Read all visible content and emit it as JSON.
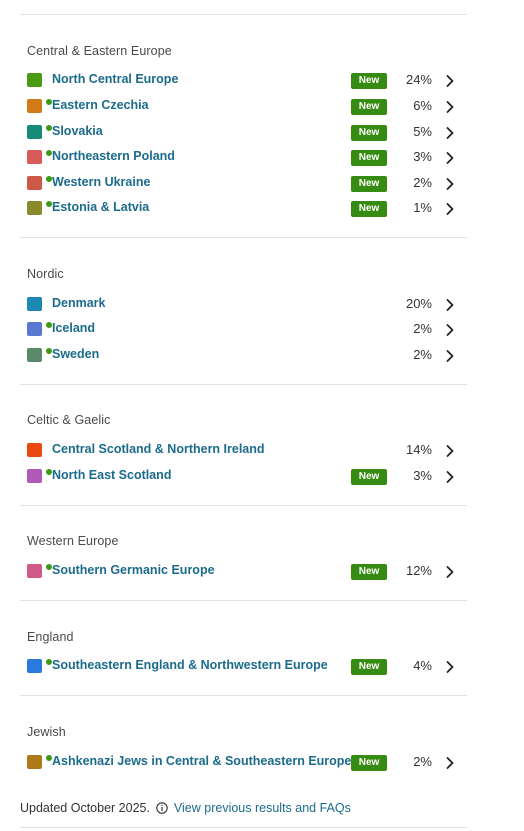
{
  "sections": [
    {
      "title": "Central & Eastern Europe",
      "regions": [
        {
          "name": "North Central Europe",
          "percent": "24%",
          "new_label": "New",
          "color": "#4a9a12",
          "dot": false
        },
        {
          "name": "Eastern Czechia",
          "percent": "6%",
          "new_label": "New",
          "color": "#d07a18",
          "dot": true
        },
        {
          "name": "Slovakia",
          "percent": "5%",
          "new_label": "New",
          "color": "#178a78",
          "dot": true
        },
        {
          "name": "Northeastern Poland",
          "percent": "3%",
          "new_label": "New",
          "color": "#d85a5a",
          "dot": true
        },
        {
          "name": "Western Ukraine",
          "percent": "2%",
          "new_label": "New",
          "color": "#cc5848",
          "dot": true
        },
        {
          "name": "Estonia & Latvia",
          "percent": "1%",
          "new_label": "New",
          "color": "#8a8a2a",
          "dot": true
        }
      ]
    },
    {
      "title": "Nordic",
      "regions": [
        {
          "name": "Denmark",
          "percent": "20%",
          "new_label": "",
          "color": "#1a88b0",
          "dot": false
        },
        {
          "name": "Iceland",
          "percent": "2%",
          "new_label": "",
          "color": "#5a78d0",
          "dot": true
        },
        {
          "name": "Sweden",
          "percent": "2%",
          "new_label": "",
          "color": "#5a8a6a",
          "dot": true
        }
      ]
    },
    {
      "title": "Celtic & Gaelic",
      "regions": [
        {
          "name": "Central Scotland & Northern Ireland",
          "percent": "14%",
          "new_label": "",
          "color": "#e84a12",
          "dot": false
        },
        {
          "name": "North East Scotland",
          "percent": "3%",
          "new_label": "New",
          "color": "#b05ab8",
          "dot": true
        }
      ]
    },
    {
      "title": "Western Europe",
      "regions": [
        {
          "name": "Southern Germanic Europe",
          "percent": "12%",
          "new_label": "New",
          "color": "#d05a88",
          "dot": true
        }
      ]
    },
    {
      "title": "England",
      "regions": [
        {
          "name": "Southeastern England & Northwestern Europe",
          "percent": "4%",
          "new_label": "New",
          "color": "#2a7ae0",
          "dot": true
        }
      ]
    },
    {
      "title": "Jewish",
      "regions": [
        {
          "name": "Ashkenazi Jews in Central & Southeastern Europe",
          "percent": "2%",
          "new_label": "New",
          "color": "#b07a18",
          "dot": true
        }
      ]
    }
  ],
  "icons": {
    "chevron": "chevron-right-icon",
    "info": "info-icon"
  },
  "footer": {
    "updated_text": "Updated October 2025.",
    "link_text": "View previous results and FAQs"
  },
  "colors": {
    "link": "#1b6b8c",
    "badge": "#368c12",
    "dot": "#3a9a14"
  }
}
